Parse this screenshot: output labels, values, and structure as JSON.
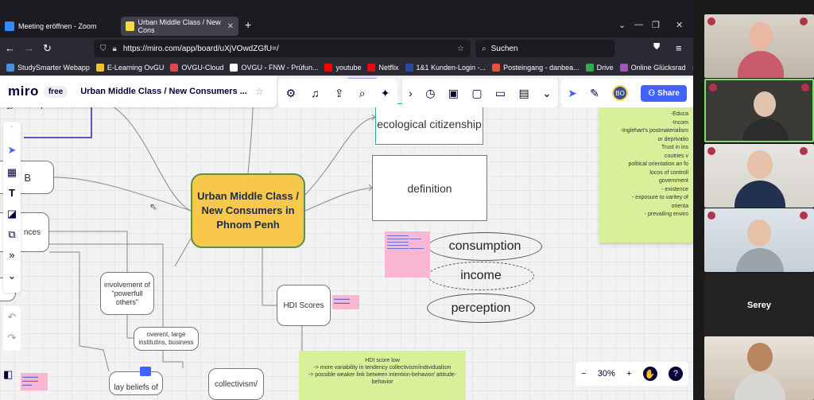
{
  "browser": {
    "tabs": [
      {
        "label": "Meeting eröffnen - Zoom",
        "favicon": "zoom-icon"
      },
      {
        "label": "Urban Middle Class / New Cons",
        "favicon": "miro-icon"
      }
    ],
    "url": "https://miro.com/app/board/uXjVOwdZGfU=/",
    "search_placeholder": "Suchen",
    "bookmarks": [
      {
        "label": "StudySmarter Webapp",
        "color": "#4a90e2"
      },
      {
        "label": "E-Learning OvGU",
        "color": "#f0c330"
      },
      {
        "label": "OVGU-Cloud",
        "color": "#e0464e"
      },
      {
        "label": "OVGU - FNW - Prüfun...",
        "color": "#ffffff"
      },
      {
        "label": "youtube",
        "color": "#ff0000"
      },
      {
        "label": "Netflix",
        "color": "#e50914"
      },
      {
        "label": "1&1 Kunden-Login -...",
        "color": "#2a4a9c"
      },
      {
        "label": "Posteingang - danbea...",
        "color": "#e94e3c"
      },
      {
        "label": "Drive",
        "color": "#34a853"
      },
      {
        "label": "Online Glücksrad",
        "color": "#9b59b6"
      }
    ],
    "overflow": "»"
  },
  "miro": {
    "logo": "miro",
    "plan": "free",
    "board_title": "Urban Middle Class / New Consumers ...",
    "share_label": "Share",
    "avatar_initials": "BO",
    "zoom_level": "30%",
    "zoom_minus": "−",
    "zoom_plus": "+",
    "help": "?",
    "accent": "#4262ff",
    "board": {
      "central": "Urban Middle Class / New Consumers in Phnom Penh",
      "ecological": "ecological citizenship",
      "definition": "definition",
      "consumption": "consumption",
      "income": "income",
      "perception": "perception",
      "hdi_scores": "HDI Scores",
      "powerful": "involvement of \"powerfull others\"",
      "overent": "overent, large institutins, business",
      "lay_beliefs": "lay beliefs of",
      "collectivism": "collectivism/",
      "b_card": "B",
      "nces_card": "nces",
      "energy": "ergy consumption",
      "hdi_note_lines": [
        "HDI score low",
        "-> more variability in tendency collectivism/individualism",
        "-> possible weaker link between intention-behavior/ attitude-",
        "behavior"
      ],
      "right_note_lines": [
        "-Educa",
        "-Incom",
        "-Inglehart's postmaterialism",
        "or deprivatio",
        "Trust in ins",
        "coutries v",
        "political orientation an fo",
        "locos of controll",
        "government",
        "- existence",
        "- exposure to varitey of",
        "orienta",
        "- prevailing enviro"
      ]
    }
  },
  "zoom": {
    "participants": [
      {
        "name": "",
        "kind": "video"
      },
      {
        "name": "",
        "kind": "video",
        "speaking": true
      },
      {
        "name": "",
        "kind": "video"
      },
      {
        "name": "",
        "kind": "video"
      },
      {
        "name": "Serey",
        "kind": "name-only"
      },
      {
        "name": "",
        "kind": "video"
      }
    ],
    "speaking_color": "#7ee06a"
  }
}
